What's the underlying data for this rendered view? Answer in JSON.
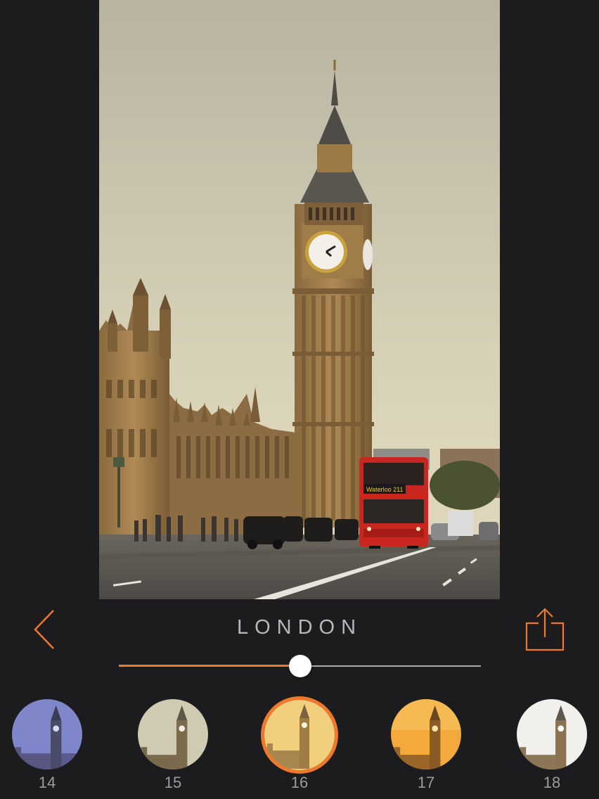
{
  "photo": {
    "subject": "Big Ben and red double-decker bus on Westminster Bridge",
    "bus_sign": "Waterloo 211"
  },
  "toolbar": {
    "back_icon": "chevron-left-icon",
    "share_icon": "share-icon",
    "filter_name": "LONDON"
  },
  "slider": {
    "value": 0.5
  },
  "filters": [
    {
      "label": "14",
      "tint": "#7f86c9",
      "selected": false
    },
    {
      "label": "15",
      "tint": "#cfcab2",
      "selected": false
    },
    {
      "label": "16",
      "tint": "#f2cf7c",
      "selected": true
    },
    {
      "label": "17",
      "tint": "#f3a93b",
      "selected": false
    },
    {
      "label": "18",
      "tint": "#f1f0ec",
      "selected": false
    }
  ],
  "colors": {
    "accent": "#f0782a",
    "background": "#1c1c1e",
    "text": "#b8b8bc"
  }
}
